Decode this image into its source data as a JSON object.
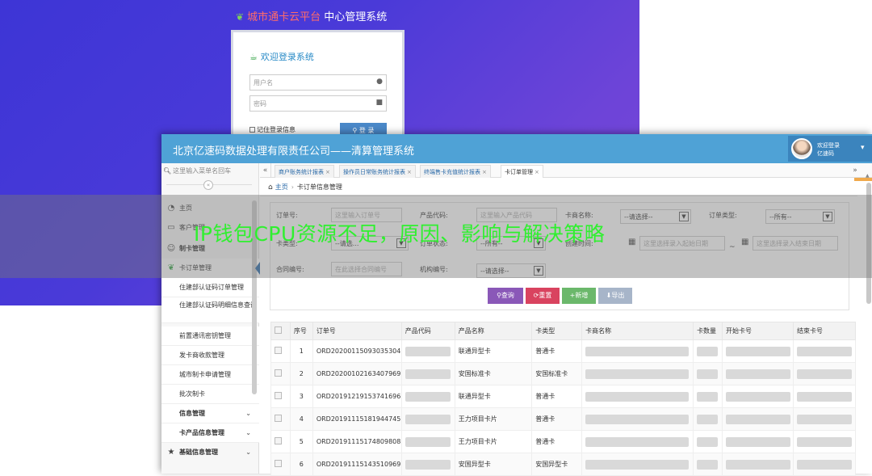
{
  "login": {
    "title_brand": "城市通卡云平台",
    "title_rest": " 中心管理系统",
    "heading": "欢迎登录系统",
    "username_placeholder": "用户名",
    "password_placeholder": "密码",
    "remember_label": "记住登录信息",
    "login_button": "登 录"
  },
  "app": {
    "title": "北京亿速码数据处理有限责任公司——清算管理系统",
    "user_greeting": "欢迎登录",
    "user_name": "亿速码"
  },
  "sidebar": {
    "search_placeholder": "这里输入菜单名回车",
    "items": [
      {
        "label": "主页",
        "icon": "dashboard-icon"
      },
      {
        "label": "客户管理",
        "icon": "card-icon"
      },
      {
        "label": "制卡管理",
        "icon": "smile-icon"
      },
      {
        "label": "卡订单管理",
        "icon": "leaf-icon"
      },
      {
        "label": "住建部认证码订单管理"
      },
      {
        "label": "住建部认证码明细信息查询"
      },
      {
        "label": "前置通讯密钥管理"
      },
      {
        "label": "发卡商收款管理"
      },
      {
        "label": "城市制卡申请管理"
      },
      {
        "label": "批次制卡"
      },
      {
        "label": "信息管理"
      },
      {
        "label": "卡产品信息管理"
      },
      {
        "label": "基础信息管理",
        "icon": "star-icon"
      }
    ]
  },
  "tabs": [
    {
      "label": "商户账务统计报表"
    },
    {
      "label": "操作员日常账务统计报表"
    },
    {
      "label": "终端售卡充值统计报表"
    },
    {
      "label": "卡订单管理"
    }
  ],
  "breadcrumb": {
    "home": "主页",
    "current": "卡订单信息管理"
  },
  "filters": {
    "order_no_label": "订单号:",
    "order_no_placeholder": "这里输入订单号",
    "product_code_label": "产品代码:",
    "product_code_placeholder": "这里输入产品代码",
    "card_vendor_label": "卡商名称:",
    "card_vendor_value": "--请选择--",
    "order_type_label": "订单类型:",
    "order_type_value": "--所有--",
    "card_type_label": "卡类型:",
    "card_type_value": "--请选...",
    "order_status_label": "订单状态:",
    "order_status_value": "--所有--",
    "create_time_label": "创建时间:",
    "start_date_placeholder": "这里选择录入起始日期",
    "end_date_placeholder": "这里选择录入结束日期",
    "contract_no_label": "合同编号:",
    "contract_no_placeholder": "在此选择合同编号",
    "org_no_label": "机构编号:",
    "org_no_value": "--请选择--"
  },
  "buttons": {
    "query": "查询",
    "reset": "重置",
    "add": "新增",
    "export": "导出"
  },
  "table": {
    "headers": [
      "序号",
      "订单号",
      "产品代码",
      "产品名称",
      "卡类型",
      "卡商名称",
      "卡数量",
      "开始卡号",
      "结束卡号"
    ],
    "rows": [
      {
        "seq": "1",
        "order_no": "ORD20200115093035304",
        "product_name": "联通异型卡",
        "card_type": "普通卡"
      },
      {
        "seq": "2",
        "order_no": "ORD20200102163407969",
        "product_name": "安国标准卡",
        "card_type": "安国标准卡"
      },
      {
        "seq": "3",
        "order_no": "ORD20191219153741696",
        "product_name": "联通异型卡",
        "card_type": "普通卡"
      },
      {
        "seq": "4",
        "order_no": "ORD20191115181944745",
        "product_name": "王力项目卡片",
        "card_type": "普通卡"
      },
      {
        "seq": "5",
        "order_no": "ORD20191115174809808",
        "product_name": "王力项目卡片",
        "card_type": "普通卡"
      },
      {
        "seq": "6",
        "order_no": "ORD20191115143510969",
        "product_name": "安国异型卡",
        "card_type": "安国异型卡"
      }
    ]
  },
  "overlay": {
    "text": "IP钱包CPU资源不足，原因、影响与解决策略"
  },
  "colors": {
    "topbar": "#4fa2d6",
    "query": "#8a58b8",
    "reset": "#d9435f",
    "add": "#6bb86b",
    "export": "#a7b5c9",
    "overlay_text": "#2ff02f"
  }
}
